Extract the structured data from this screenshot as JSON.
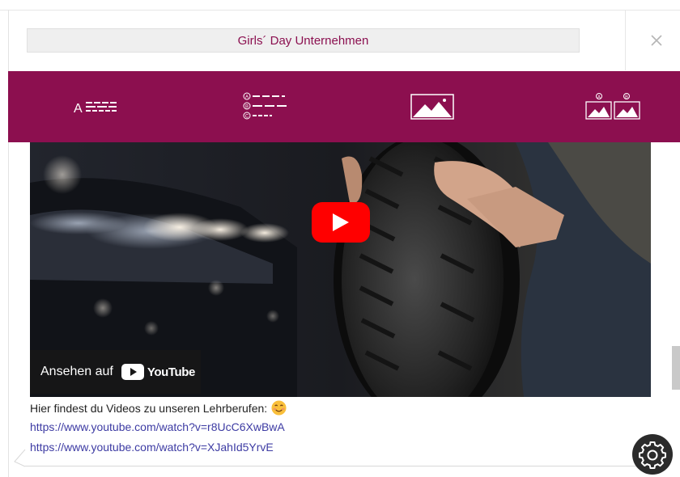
{
  "dialog": {
    "title": "Girls´ Day Unternehmen",
    "close_icon": "close-icon"
  },
  "toolbar": {
    "buttons": [
      {
        "name": "text-mode",
        "icon": "text-lines-icon",
        "glyph": "A"
      },
      {
        "name": "quiz-mode",
        "icon": "multiple-choice-icon",
        "options": [
          "A",
          "B",
          "C"
        ]
      },
      {
        "name": "image-mode",
        "icon": "image-icon"
      },
      {
        "name": "image-compare-mode",
        "icon": "image-choice-icon",
        "options": [
          "A",
          "B"
        ]
      }
    ],
    "accent": "#8c0f4f"
  },
  "video": {
    "watch_on_label": "Ansehen auf",
    "brand": "YouTube",
    "play_icon": "play-icon"
  },
  "message": {
    "text": "Hier findest du Videos zu unseren Lehrberufen:",
    "emoji": "smiling-face-emoji",
    "links": [
      "https://www.youtube.com/watch?v=r8UcC6XwBwA",
      "https://www.youtube.com/watch?v=XJahId5YrvE"
    ]
  },
  "settings": {
    "icon": "gear-icon"
  },
  "colors": {
    "title_text": "#8b1050",
    "link": "#3d3ba3",
    "youtube_red": "#ff0000"
  }
}
